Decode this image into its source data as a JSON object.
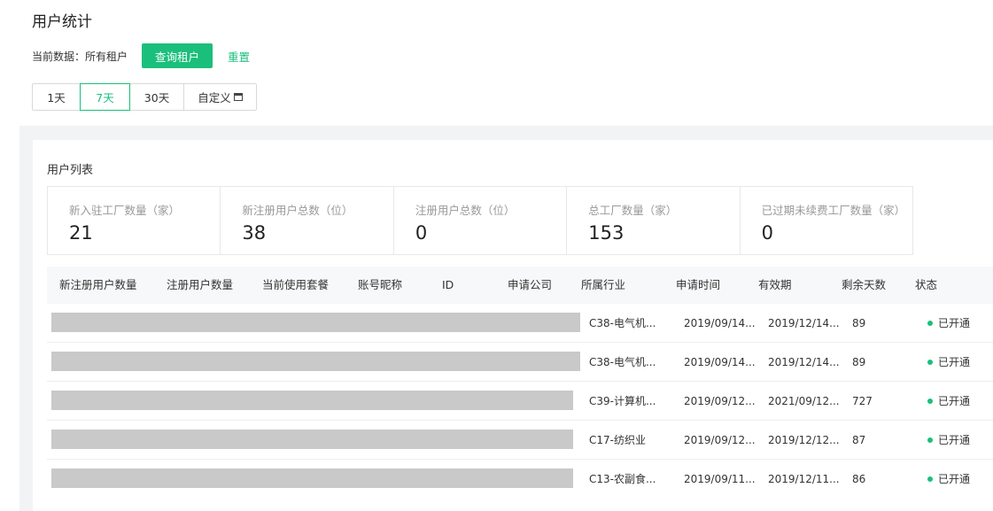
{
  "page_title": "用户统计",
  "tenant": {
    "label": "当前数据：所有租户",
    "query_button": "查询租户",
    "reset_link": "重置"
  },
  "ranges": [
    {
      "label": "1天",
      "active": false
    },
    {
      "label": "7天",
      "active": true
    },
    {
      "label": "30天",
      "active": false
    },
    {
      "label": "自定义",
      "active": false,
      "icon": "calendar-icon"
    }
  ],
  "list_title": "用户列表",
  "stats": [
    {
      "label": "新入驻工厂数量（家）",
      "value": "21"
    },
    {
      "label": "新注册用户总数（位）",
      "value": "38"
    },
    {
      "label": "注册用户总数（位）",
      "value": "0"
    },
    {
      "label": "总工厂数量（家）",
      "value": "153"
    },
    {
      "label": "已过期未续费工厂数量（家）",
      "value": "0"
    }
  ],
  "table": {
    "columns": [
      "新注册用户数量",
      "注册用户数量",
      "当前使用套餐",
      "账号昵称",
      "ID",
      "申请公司",
      "所属行业",
      "申请时间",
      "有效期",
      "剩余天数",
      "状态"
    ],
    "rows": [
      {
        "industry": "C38-电气机...",
        "apply_time": "2019/09/14...",
        "valid_until": "2019/12/14...",
        "days_left": "89",
        "status": "已开通"
      },
      {
        "industry": "C38-电气机...",
        "apply_time": "2019/09/14...",
        "valid_until": "2019/12/14...",
        "days_left": "89",
        "status": "已开通"
      },
      {
        "industry": "C39-计算机...",
        "apply_time": "2019/09/12...",
        "valid_until": "2021/09/12...",
        "days_left": "727",
        "status": "已开通"
      },
      {
        "industry": "C17-纺织业",
        "apply_time": "2019/09/12...",
        "valid_until": "2019/12/12...",
        "days_left": "87",
        "status": "已开通"
      },
      {
        "industry": "C13-农副食...",
        "apply_time": "2019/09/11...",
        "valid_until": "2019/12/11...",
        "days_left": "86",
        "status": "已开通"
      }
    ]
  },
  "colors": {
    "accent": "#1bbf7c",
    "redaction": "#c9c9c9",
    "band": "#f2f3f5"
  }
}
